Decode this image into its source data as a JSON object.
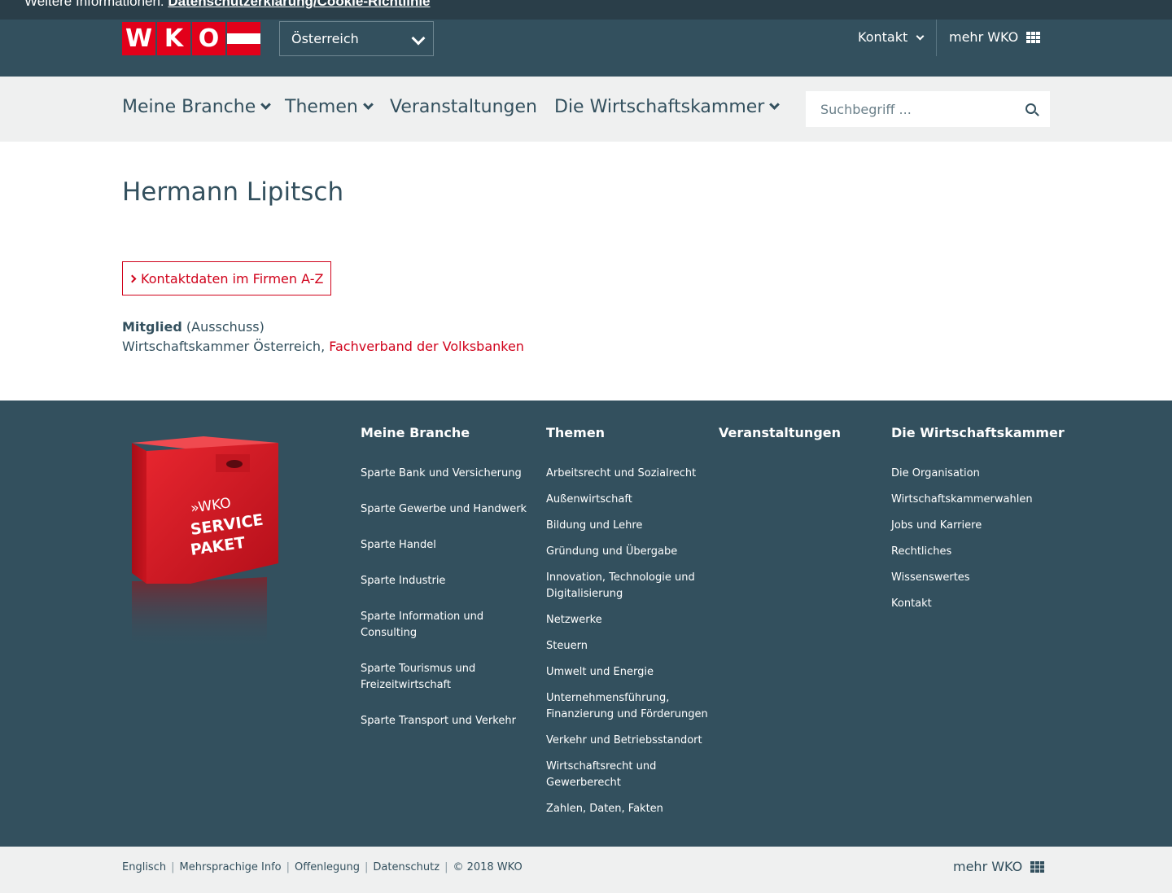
{
  "cookie_bar": {
    "prefix": "Weitere Informationen: ",
    "link": "Datenschutzerklärung/Cookie-Richtlinie"
  },
  "header": {
    "logo": {
      "letters": [
        "W",
        "K",
        "O"
      ]
    },
    "region": "Österreich",
    "kontakt": "Kontakt",
    "mehr_wko": "mehr WKO"
  },
  "nav": {
    "items": [
      {
        "label": "Meine Branche",
        "has_dropdown": true
      },
      {
        "label": "Themen",
        "has_dropdown": true
      },
      {
        "label": "Veranstaltungen",
        "has_dropdown": false
      },
      {
        "label": "Die Wirtschaftskammer",
        "has_dropdown": true
      }
    ],
    "search_placeholder": "Suchbegriff ..."
  },
  "main": {
    "title": "Hermann Lipitsch",
    "contact_button": "Kontaktdaten im Firmen A-Z",
    "role": "Mitglied",
    "role_detail": "(Ausschuss)",
    "org_plain": "Wirtschaftskammer Österreich, ",
    "org_link": "Fachverband der Volksbanken"
  },
  "footer": {
    "box": {
      "line1": "»WKO",
      "line2": "SERVICE",
      "line3": "PAKET"
    },
    "columns": [
      {
        "heading": "Meine Branche",
        "links": [
          "Sparte Bank und Versicherung",
          "Sparte Gewerbe und Handwerk",
          "Sparte Handel",
          "Sparte Industrie",
          "Sparte Information und Consulting",
          "Sparte Tourismus und Freizeitwirtschaft",
          "Sparte Transport und Verkehr"
        ]
      },
      {
        "heading": "Themen",
        "links": [
          "Arbeitsrecht und Sozialrecht",
          "Außenwirtschaft",
          "Bildung und Lehre",
          "Gründung und Übergabe",
          "Innovation, Technologie und Digitalisierung",
          "Netzwerke",
          "Steuern",
          "Umwelt und Energie",
          "Unternehmensführung, Finanzierung und Förderungen",
          "Verkehr und Betriebsstandort",
          "Wirtschaftsrecht und Gewerberecht",
          "Zahlen, Daten, Fakten"
        ]
      },
      {
        "heading": "Veranstaltungen",
        "links": []
      },
      {
        "heading": "Die Wirtschaftskammer",
        "links": [
          "Die Organisation",
          "Wirtschaftskammerwahlen",
          "Jobs und Karriere",
          "Rechtliches",
          "Wissenswertes",
          "Kontakt"
        ]
      }
    ]
  },
  "bottom": {
    "links": [
      "Englisch",
      "Mehrsprachige Info",
      "Offenlegung",
      "Datenschutz"
    ],
    "copyright": "© 2018 WKO",
    "mehr_wko": "mehr WKO"
  },
  "colors": {
    "brand_red": "#e2001a",
    "dark_teal": "#33505e",
    "nav_bg": "#eff0f0"
  }
}
